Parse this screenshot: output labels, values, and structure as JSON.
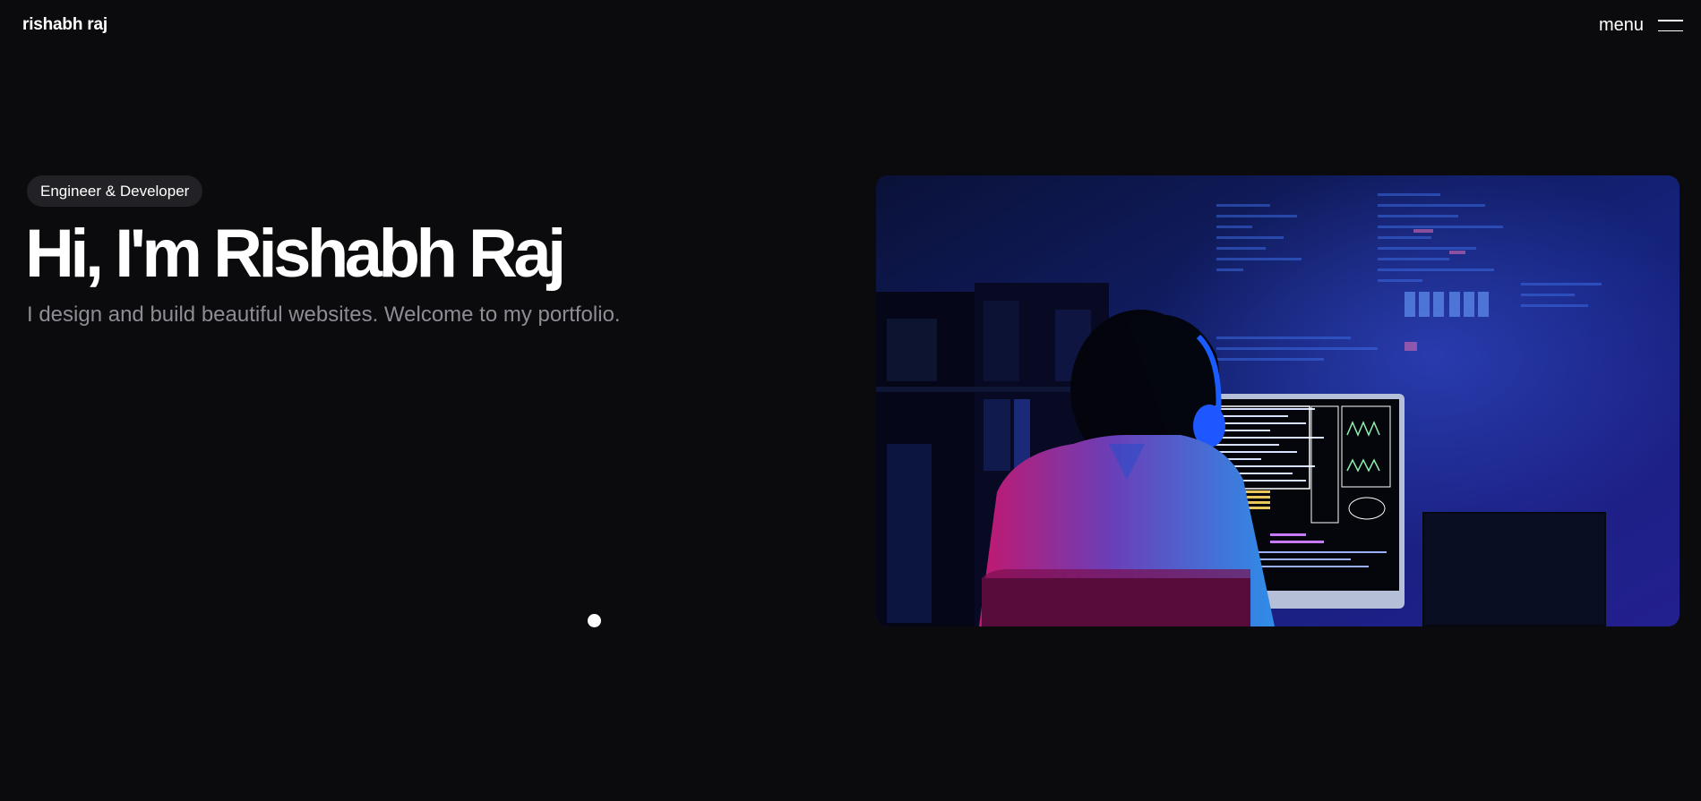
{
  "header": {
    "brand": "rishabh raj",
    "menu_label": "menu",
    "menu_icon": "hamburger-icon"
  },
  "hero": {
    "badge": "Engineer & Developer",
    "headline": "Hi, I'm Rishabh Raj",
    "subtitle": "I design and build beautiful websites. Welcome to my portfolio.",
    "image_alt": "Developer wearing headphones working at a computer with code on screen"
  },
  "colors": {
    "background": "#0b0b0d",
    "badge_background": "#222226",
    "subtitle_text": "#8d8d95",
    "image_blue": "#1e2a8a",
    "image_magenta": "#c2186f"
  }
}
